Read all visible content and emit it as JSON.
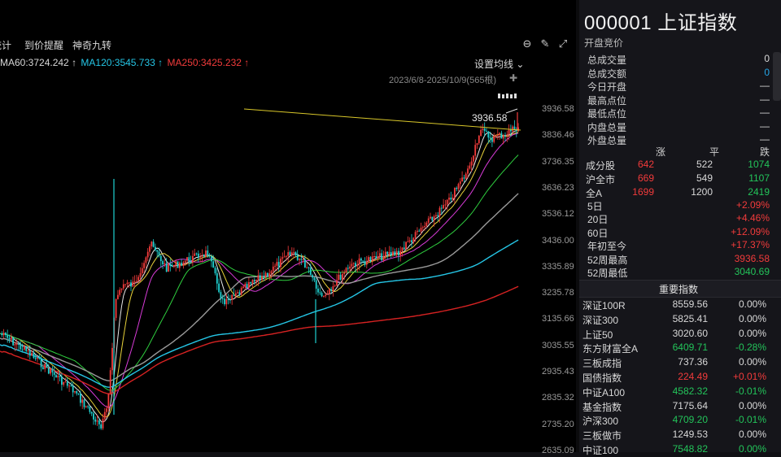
{
  "toolbar": {
    "items": [
      "统计",
      "到价提醒",
      "神奇九转"
    ],
    "items_display": [
      "统计",
      "到价提醒",
      "神奇九转"
    ]
  },
  "ma": {
    "ma60": "MA60:3724.242 ↑",
    "ma120": "MA120:3545.733 ↑",
    "ma250": "MA250:3425.232 ↑",
    "colors": {
      "ma60": "#d8d8d8",
      "ma120": "#25c6e6",
      "ma250": "#f23b3b"
    }
  },
  "settings": {
    "set_ma": "设置均线 ⌄"
  },
  "range": {
    "text": "2023/6/8-2025/10/9(565根)"
  },
  "chart": {
    "high_label": "3936.58",
    "y_ticks": [
      "3936.58",
      "3836.46",
      "3736.35",
      "3636.23",
      "3536.12",
      "3436.00",
      "3335.89",
      "3235.78",
      "3135.66",
      "3035.55",
      "2935.43",
      "2835.32",
      "2735.20",
      "2635.09"
    ]
  },
  "quote": {
    "code": "000001",
    "name": "上证指数",
    "open_auction": "开盘竞价",
    "stats": [
      {
        "label": "总成交量",
        "value": "0",
        "color": "white"
      },
      {
        "label": "总成交额",
        "value": "0",
        "color": "blue"
      },
      {
        "label": "今日开盘",
        "value": "—",
        "color": "white"
      },
      {
        "label": "最高点位",
        "value": "—",
        "color": "white"
      },
      {
        "label": "最低点位",
        "value": "—",
        "color": "white"
      },
      {
        "label": "内盘总量",
        "value": "—",
        "color": "white"
      },
      {
        "label": "外盘总量",
        "value": "—",
        "color": "white"
      }
    ]
  },
  "breadth": {
    "headers": [
      "涨",
      "平",
      "跌"
    ],
    "rows": [
      {
        "label": "成分股",
        "up": "642",
        "flat": "522",
        "down": "1074"
      },
      {
        "label": "沪全市",
        "up": "669",
        "flat": "549",
        "down": "1107"
      },
      {
        "label": "全A",
        "up": "1699",
        "flat": "1200",
        "down": "2419"
      }
    ]
  },
  "performance": [
    {
      "label": "5日",
      "value": "+2.09%"
    },
    {
      "label": "20日",
      "value": "+4.46%"
    },
    {
      "label": "60日",
      "value": "+12.09%"
    },
    {
      "label": "年初至今",
      "value": "+17.37%"
    },
    {
      "label": "52周最高",
      "value": "3936.58"
    },
    {
      "label": "52周最低",
      "value": "3040.69"
    }
  ],
  "indices_title": "重要指数",
  "indices": [
    {
      "name": "深证100R",
      "price": "8559.56",
      "change": "0.00%",
      "color": "white"
    },
    {
      "name": "深证300",
      "price": "5825.41",
      "change": "0.00%",
      "color": "white"
    },
    {
      "name": "上证50",
      "price": "3020.60",
      "change": "0.00%",
      "color": "white"
    },
    {
      "name": "东方财富全A",
      "price": "6409.71",
      "change": "-0.28%",
      "color": "green"
    },
    {
      "name": "三板成指",
      "price": "737.36",
      "change": "0.00%",
      "color": "white"
    },
    {
      "name": "国债指数",
      "price": "224.49",
      "change": "+0.01%",
      "color": "red"
    },
    {
      "name": "中证A100",
      "price": "4582.32",
      "change": "-0.01%",
      "color": "green"
    },
    {
      "name": "基金指数",
      "price": "7175.64",
      "change": "0.00%",
      "color": "white"
    },
    {
      "name": "沪深300",
      "price": "4709.20",
      "change": "-0.01%",
      "color": "green"
    },
    {
      "name": "三板做市",
      "price": "1249.53",
      "change": "0.00%",
      "color": "white"
    },
    {
      "name": "中证100",
      "price": "7548.82",
      "change": "0.00%",
      "color": "green"
    }
  ]
}
